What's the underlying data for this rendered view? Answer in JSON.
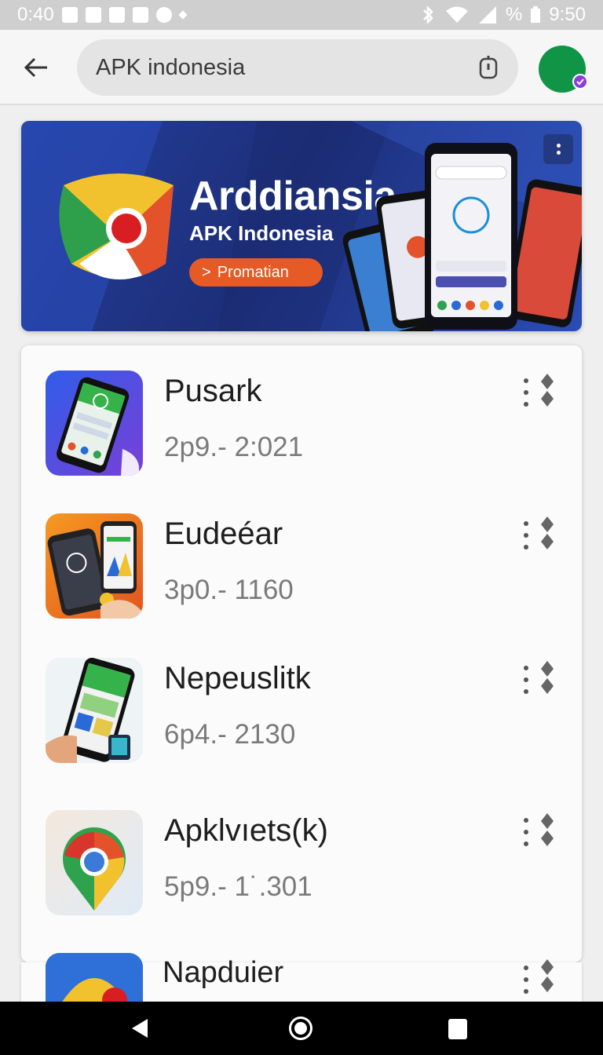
{
  "status_bar": {
    "left_time": "0:40",
    "right_time": "9:50",
    "battery_symbol": "%",
    "icons_left": [
      "screenshot-icon",
      "image-icon",
      "sim-icon",
      "photo-icon",
      "circle-icon",
      "dot-icon"
    ],
    "icons_right": [
      "bluetooth-icon",
      "wifi-icon",
      "signal-icon",
      "battery-icon"
    ]
  },
  "header": {
    "back_icon": "arrow-left-icon",
    "search_text": "APK indonesia",
    "mic_icon": "mic-icon",
    "avatar_color": "#109446",
    "avatar_badge_color": "#8a3de0"
  },
  "banner": {
    "title": "Arddiansia",
    "subtitle": "APK Indonesia",
    "promo_label": "Promatian",
    "promo_arrow": ">",
    "menu_icon": "more-vertical-icon",
    "background_color": "#243f9c",
    "promo_color": "#e55a25"
  },
  "apps": [
    {
      "name": "Pusark",
      "meta": "2p9.- 2:021",
      "icon": "phone-app-icon-purple"
    },
    {
      "name": "Eudeéar",
      "meta": "3p0.- 1160",
      "icon": "phone-app-icon-orange"
    },
    {
      "name": "Nepeuslitk",
      "meta": "6p4.- 2130",
      "icon": "phone-app-icon-green"
    },
    {
      "name": "Apklvıets(k)",
      "meta": "5p9.- 1˙.301",
      "icon": "chrome-map-icon"
    },
    {
      "name": "Napduier",
      "meta": "",
      "icon": "map-pin-icon"
    }
  ],
  "nav_bar": {
    "back_icon": "nav-back-icon",
    "home_icon": "nav-home-icon",
    "recents_icon": "nav-recents-icon"
  }
}
